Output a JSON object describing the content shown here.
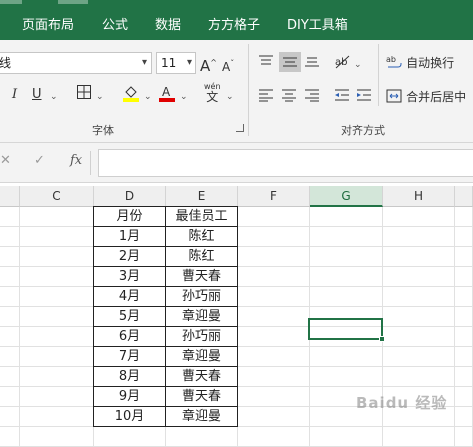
{
  "ribbon_tabs": [
    "页面布局",
    "公式",
    "数据",
    "方方格子",
    "DIY工具箱"
  ],
  "font": {
    "name": "线",
    "size": "11"
  },
  "buttons": {
    "grow_font": "A",
    "shrink_font": "A",
    "italic": "I",
    "underline": "U",
    "wen_top": "wén",
    "wen_bottom": "文",
    "wrap_text": "自动换行",
    "merge_center": "合并后居中"
  },
  "groups": {
    "font": "字体",
    "alignment": "对齐方式"
  },
  "formula_bar": {
    "cancel": "✕",
    "enter": "✓",
    "fx": "fx",
    "value": ""
  },
  "columns": [
    "C",
    "D",
    "E",
    "F",
    "G",
    "H"
  ],
  "selected_column": "G",
  "table": {
    "header": [
      "月份",
      "最佳员工"
    ],
    "rows": [
      [
        "1月",
        "陈红"
      ],
      [
        "2月",
        "陈红"
      ],
      [
        "3月",
        "曹天春"
      ],
      [
        "4月",
        "孙巧丽"
      ],
      [
        "5月",
        "章迎曼"
      ],
      [
        "6月",
        "孙巧丽"
      ],
      [
        "7月",
        "章迎曼"
      ],
      [
        "8月",
        "曹天春"
      ],
      [
        "9月",
        "曹天春"
      ],
      [
        "10月",
        "章迎曼"
      ]
    ]
  },
  "watermark": "Baidu 经验",
  "colors": {
    "accent": "#217346"
  }
}
